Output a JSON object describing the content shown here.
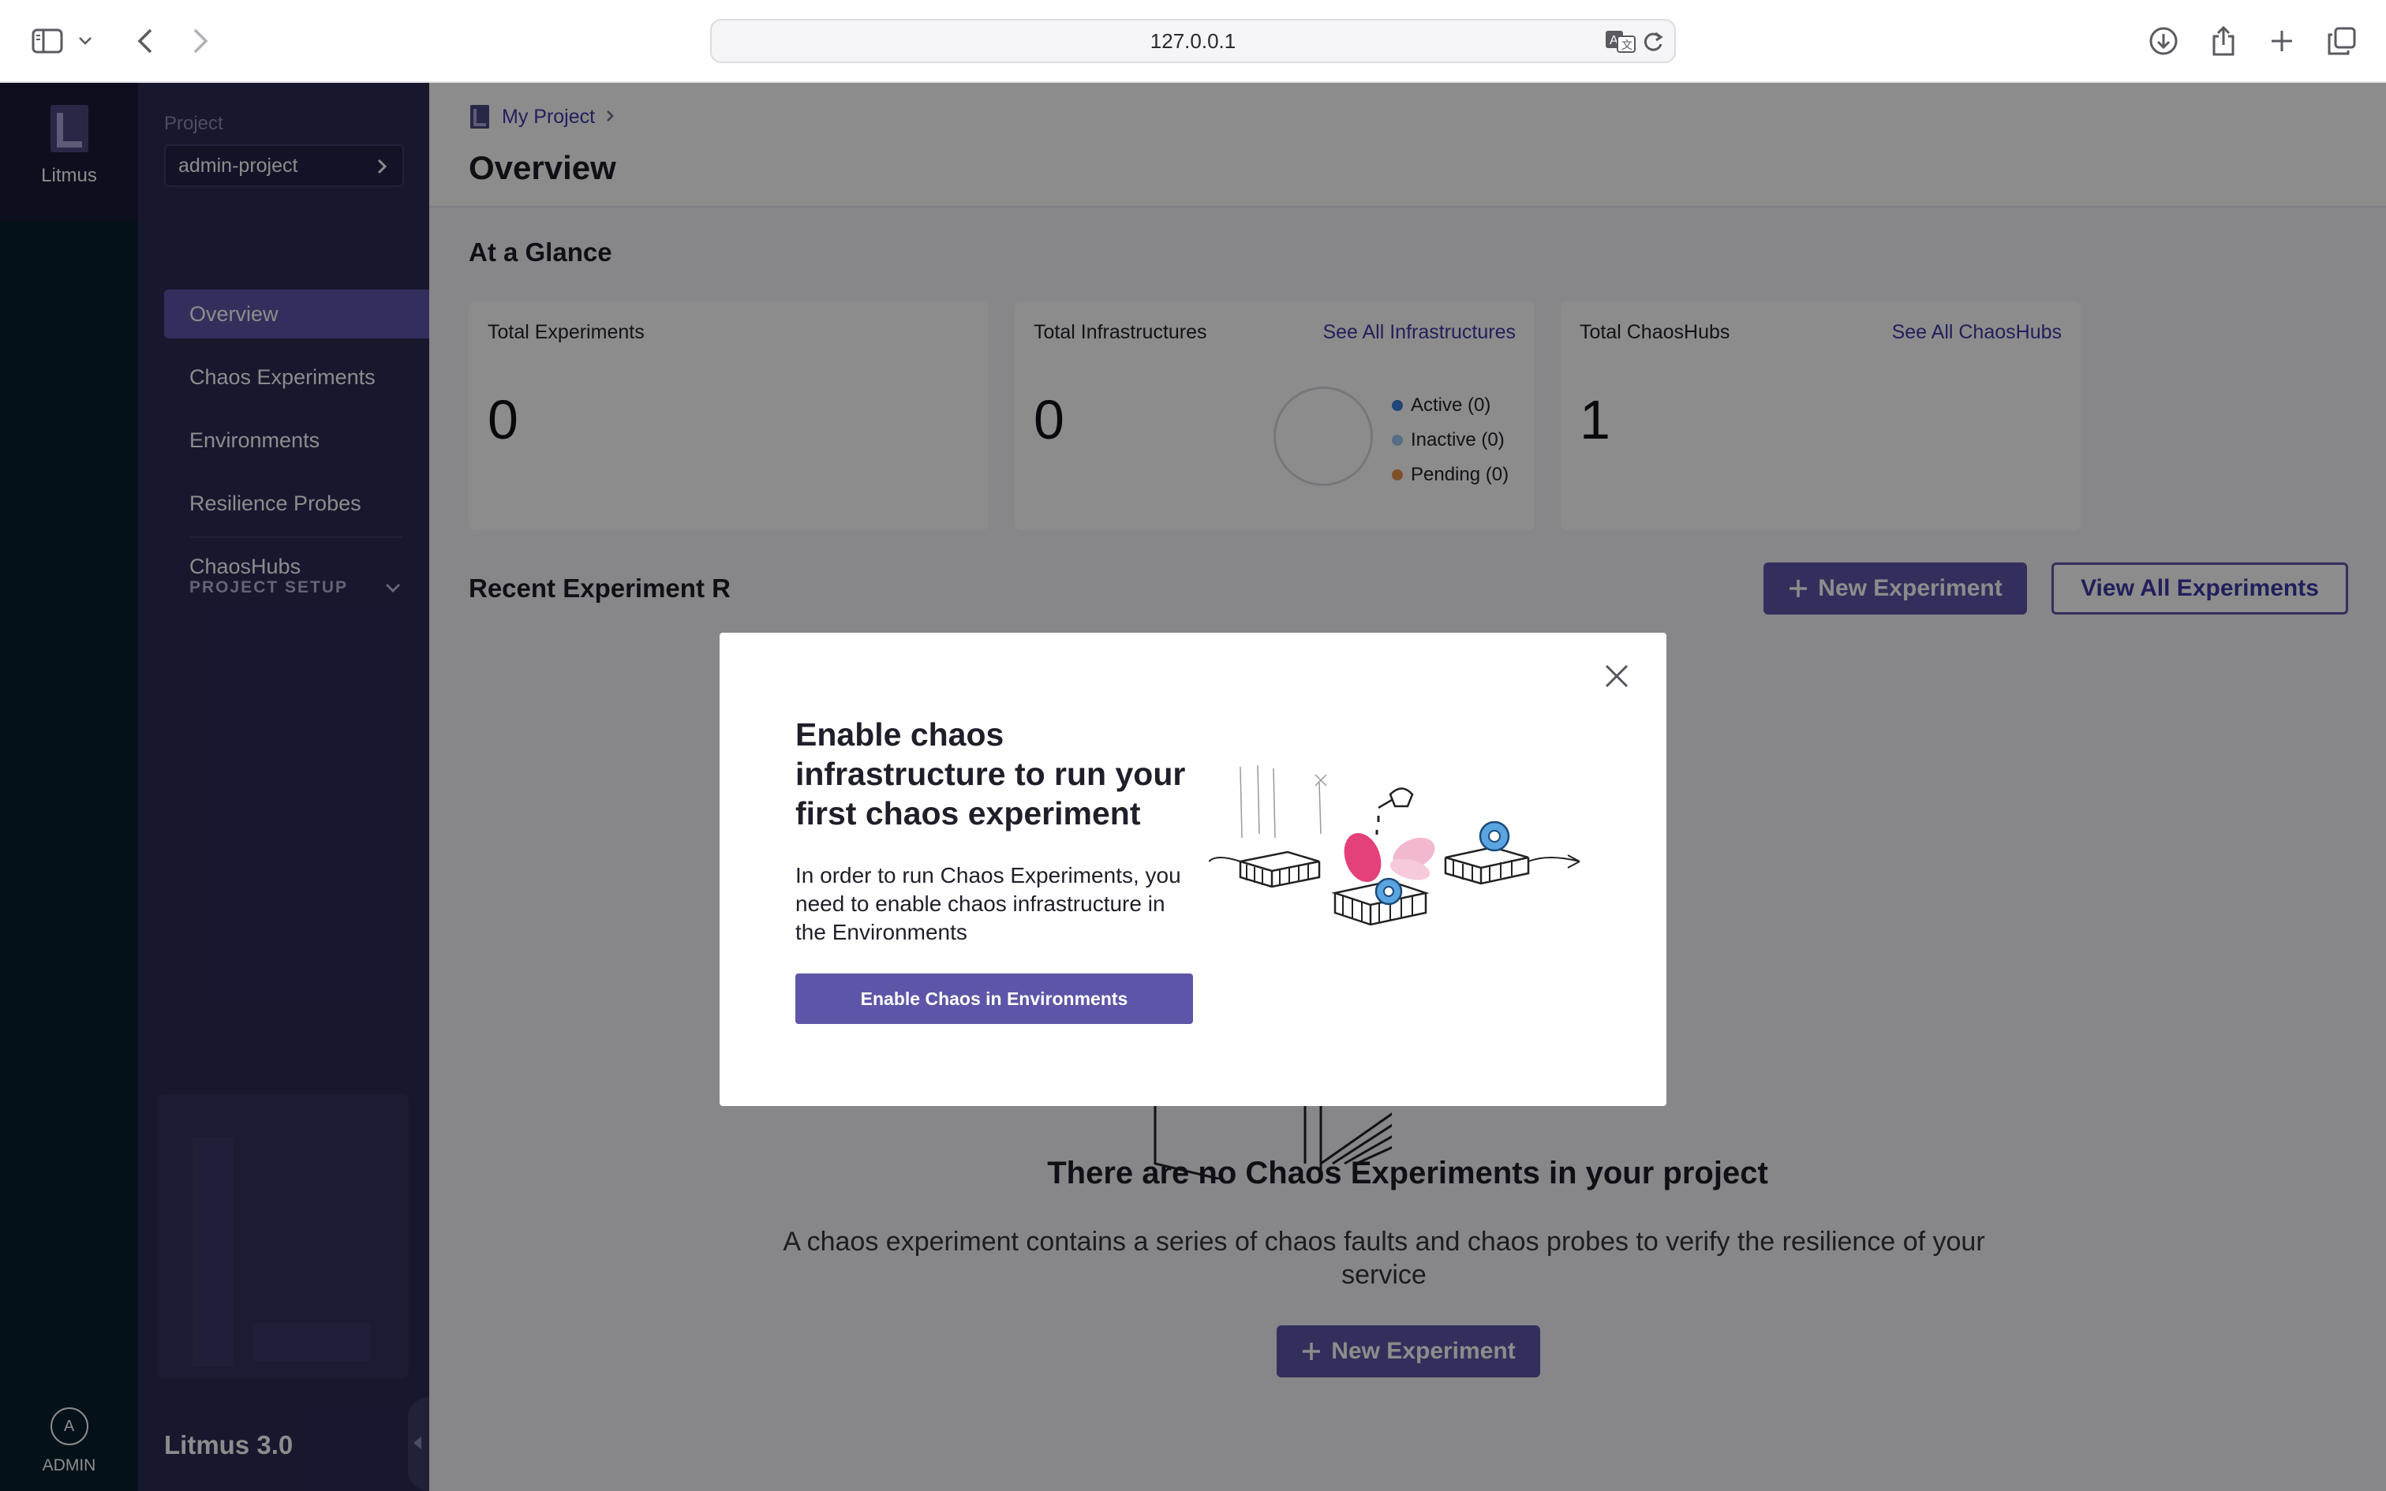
{
  "browser": {
    "url": "127.0.0.1"
  },
  "rail": {
    "app_name": "Litmus",
    "user_initial": "A",
    "user_label": "ADMIN"
  },
  "sidebar": {
    "project_label": "Project",
    "project_name": "admin-project",
    "items": [
      {
        "label": "Overview",
        "active": true
      },
      {
        "label": "Chaos Experiments",
        "active": false
      },
      {
        "label": "Environments",
        "active": false
      },
      {
        "label": "Resilience Probes",
        "active": false
      },
      {
        "label": "ChaosHubs",
        "active": false
      }
    ],
    "setup_label": "PROJECT SETUP",
    "version": "Litmus 3.0"
  },
  "header": {
    "breadcrumb": "My Project",
    "title": "Overview"
  },
  "glance": {
    "title": "At a Glance",
    "cards": [
      {
        "label": "Total Experiments",
        "value": "0",
        "link": ""
      },
      {
        "label": "Total Infrastructures",
        "value": "0",
        "link": "See All Infrastructures"
      },
      {
        "label": "Total ChaosHubs",
        "value": "1",
        "link": "See All ChaosHubs"
      }
    ],
    "legend": [
      {
        "label": "Active (0)",
        "color": "#3b7fd9"
      },
      {
        "label": "Inactive (0)",
        "color": "#9fc7f2"
      },
      {
        "label": "Pending (0)",
        "color": "#e8924a"
      }
    ]
  },
  "recent": {
    "title": "Recent Experiment R",
    "new_button": "New Experiment",
    "view_all_button": "View All Experiments"
  },
  "empty_state": {
    "title": "There are no Chaos Experiments in your project",
    "description": "A chaos experiment contains a series of chaos faults and chaos probes to verify the resilience of your service",
    "button": "New Experiment"
  },
  "modal": {
    "title": "Enable chaos infrastructure to run your first chaos experiment",
    "description": "In order to run Chaos Experiments, you need to enable chaos infrastructure in the Environments",
    "button": "Enable Chaos in Environments"
  },
  "colors": {
    "brand": "#5d56a8",
    "link": "#3d3aa6",
    "rail": "#0a1f2e",
    "sidebar": "#2b2a55"
  },
  "icons": [
    "sidebar-toggle-icon",
    "chevron-down-icon",
    "back-arrow-icon",
    "forward-arrow-icon",
    "translate-icon",
    "reload-icon",
    "download-icon",
    "share-icon",
    "plus-icon",
    "tabs-icon",
    "litmus-logo-icon",
    "close-icon",
    "plus-icon"
  ]
}
